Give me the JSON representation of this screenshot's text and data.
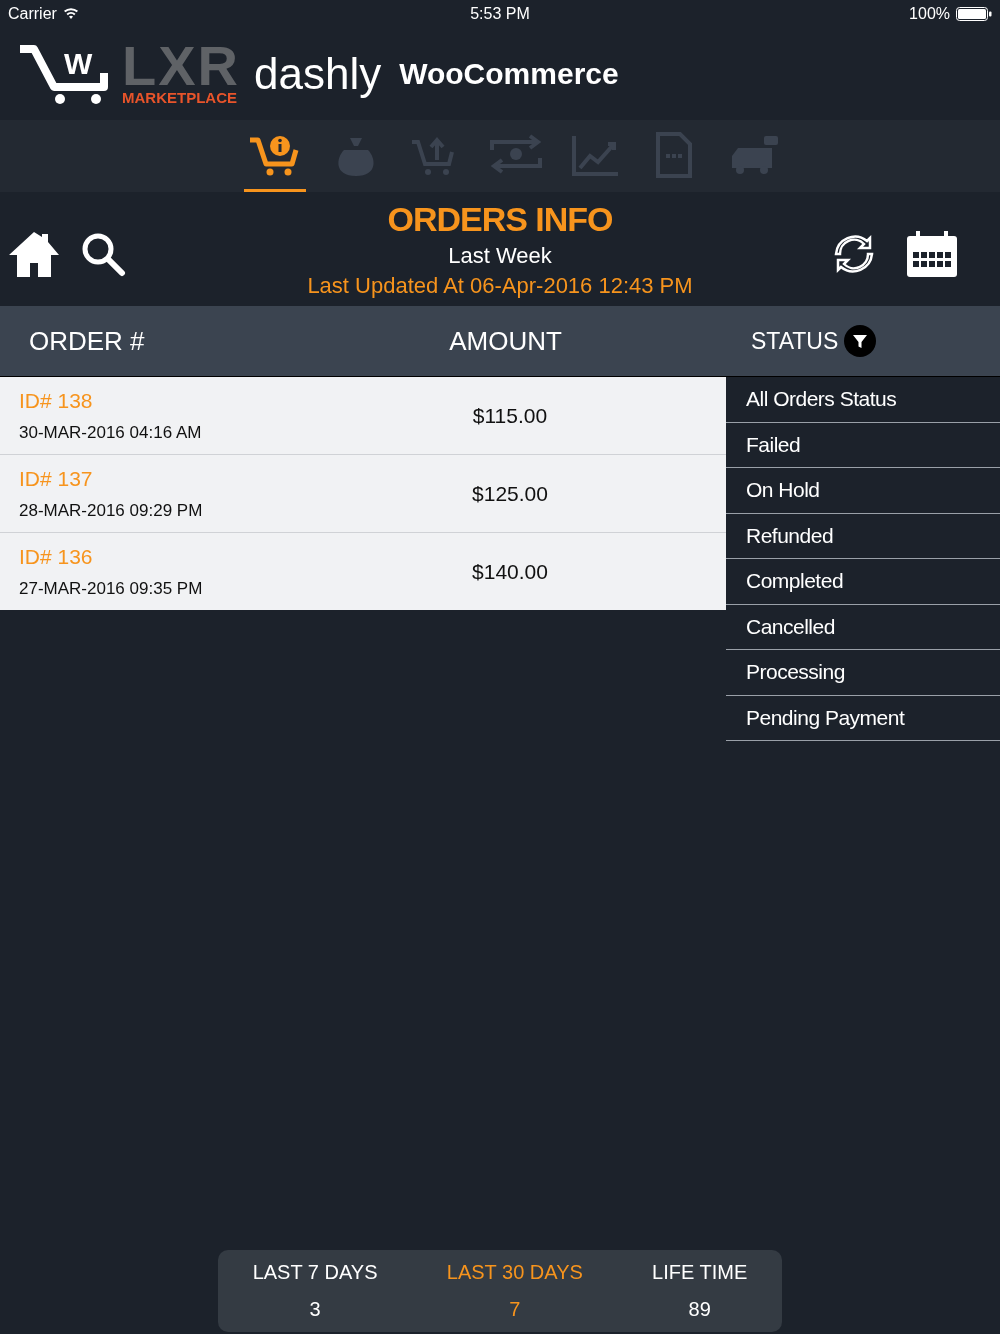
{
  "status_bar": {
    "carrier": "Carrier",
    "time": "5:53 PM",
    "battery": "100%"
  },
  "logo": {
    "cart_letter": "W",
    "brand": "LXR",
    "brand_sub": "MARKETPLACE",
    "product": "dashly",
    "platform": "WooCommerce"
  },
  "tabs": [
    {
      "kind": "orders",
      "selected": true
    },
    {
      "kind": "money",
      "selected": false
    },
    {
      "kind": "upload",
      "selected": false
    },
    {
      "kind": "sync",
      "selected": false
    },
    {
      "kind": "growth",
      "selected": false
    },
    {
      "kind": "document",
      "selected": false
    },
    {
      "kind": "truck",
      "selected": false
    }
  ],
  "header": {
    "title": "ORDERS INFO",
    "period": "Last Week",
    "updated": "Last Updated At 06-Apr-2016 12:43 PM"
  },
  "table": {
    "columns": [
      "ORDER #",
      "AMOUNT",
      "STATUS"
    ],
    "rows": [
      {
        "id": "ID# 138",
        "date": "30-MAR-2016 04:16 AM",
        "amount": "$115.00"
      },
      {
        "id": "ID# 137",
        "date": "28-MAR-2016 09:29 PM",
        "amount": "$125.00"
      },
      {
        "id": "ID# 136",
        "date": "27-MAR-2016 09:35 PM",
        "amount": "$140.00"
      }
    ]
  },
  "status_menu": [
    "All Orders Status",
    "Failed",
    "On Hold",
    "Refunded",
    "Completed",
    "Cancelled",
    "Processing",
    "Pending Payment"
  ],
  "summary": [
    {
      "label": "LAST 7 DAYS",
      "value": "3",
      "selected": false
    },
    {
      "label": "LAST 30 DAYS",
      "value": "7",
      "selected": true
    },
    {
      "label": "LIFE TIME",
      "value": "89",
      "selected": false
    }
  ]
}
